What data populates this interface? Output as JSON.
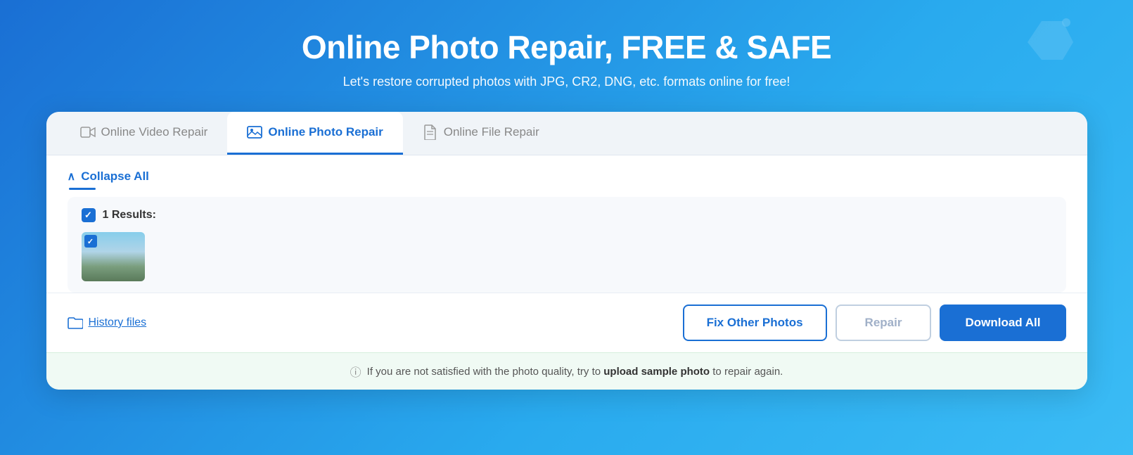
{
  "hero": {
    "title": "Online Photo Repair, FREE & SAFE",
    "subtitle": "Let's restore corrupted photos with JPG, CR2, DNG, etc. formats online for free!"
  },
  "tabs": [
    {
      "id": "video",
      "label": "Online Video Repair",
      "active": false
    },
    {
      "id": "photo",
      "label": "Online Photo Repair",
      "active": true
    },
    {
      "id": "file",
      "label": "Online File Repair",
      "active": false
    }
  ],
  "collapse": {
    "label": "Collapse All"
  },
  "results": {
    "count_label": "1 Results:"
  },
  "history": {
    "label": "History files"
  },
  "buttons": {
    "fix_other": "Fix Other Photos",
    "repair": "Repair",
    "download_all": "Download All"
  },
  "info": {
    "prefix": "If you are not satisfied with the photo quality, try to",
    "link": "upload sample photo",
    "suffix": "to repair again."
  }
}
